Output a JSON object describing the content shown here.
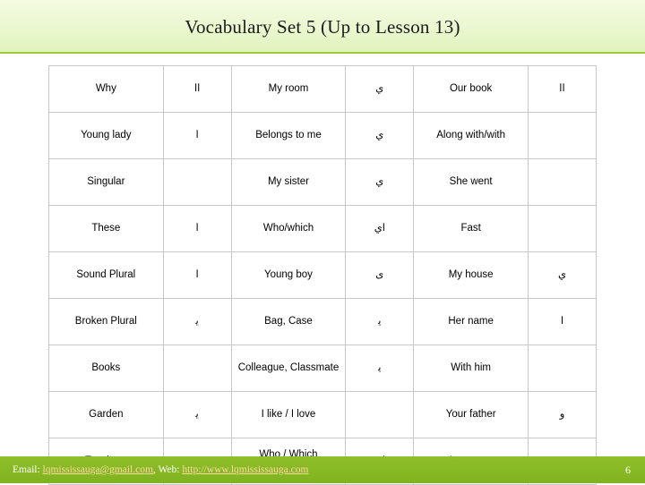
{
  "slide": {
    "title": "Vocabulary Set 5 (Up to Lesson 13)",
    "page_number": "6",
    "accent_color": "#8fbf2a",
    "title_band_color": "#eaf7cf"
  },
  "table": {
    "rows": [
      {
        "c1_en": "Why",
        "c1_ar": "اا",
        "c2_en": "My room",
        "c2_ar": "ي",
        "c3_en": "Our book",
        "c3_ar": "اا"
      },
      {
        "c1_en": "Young lady",
        "c1_ar": "ا",
        "c2_en": "Belongs to me",
        "c2_ar": "ي",
        "c3_en": "Along with/with",
        "c3_ar": ""
      },
      {
        "c1_en": "Singular",
        "c1_ar": "",
        "c2_en": "My sister",
        "c2_ar": "ي",
        "c3_en": "She went",
        "c3_ar": ""
      },
      {
        "c1_en": "These",
        "c1_ar": "ا",
        "c2_en": "Who/which",
        "c2_ar": "اي",
        "c3_en": "Fast",
        "c3_ar": ""
      },
      {
        "c1_en": "Sound Plural",
        "c1_ar": "ا",
        "c2_en": "Young boy",
        "c2_ar": "ى",
        "c3_en": "My house",
        "c3_ar": "ي"
      },
      {
        "c1_en": "Broken Plural",
        "c1_ar": "ﻳ",
        "c2_en": "Bag, Case",
        "c2_ar": "ﻳ",
        "c3_en": "Her name",
        "c3_ar": "ا"
      },
      {
        "c1_en": "Books",
        "c1_ar": "",
        "c2_en": "Colleague, Classmate",
        "c2_ar": "ﻳ",
        "c3_en": "With him",
        "c3_ar": ""
      },
      {
        "c1_en": "Garden",
        "c1_ar": "ﻳ",
        "c2_en": "I like / I love",
        "c2_ar": "",
        "c3_en": "Your father",
        "c3_ar": "و"
      },
      {
        "c1_en": "Teachers",
        "c1_ar": "و",
        "c2_en": "Who / Which (Feminine)",
        "c2_ar": "اي",
        "c3_en": "Inspector",
        "c3_ar": ""
      }
    ]
  },
  "footer": {
    "email_label": "Email:",
    "email_value": "lqmississauga@gmail.com",
    "web_label": "Web:",
    "web_value": "http://www.lqmississauga.com"
  }
}
